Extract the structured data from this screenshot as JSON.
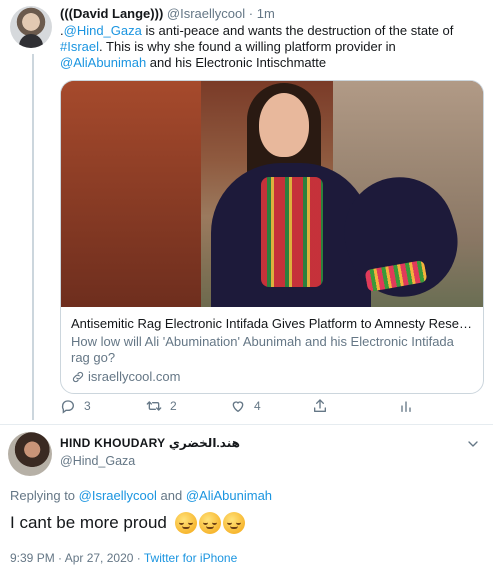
{
  "parent_tweet": {
    "display_name": "(((David Lange)))",
    "handle": "@Israellycool",
    "separator": "·",
    "time": "1m",
    "text_parts": [
      {
        "text": ".",
        "link": false
      },
      {
        "text": "@Hind_Gaza",
        "link": true
      },
      {
        "text": " is anti-peace and wants the destruction of the state of ",
        "link": false
      },
      {
        "text": "#Israel",
        "link": true
      },
      {
        "text": ". This is why she found a willing platform provider in ",
        "link": false
      },
      {
        "text": "@AliAbunimah",
        "link": true
      },
      {
        "text": " and his Electronic Intischmatte",
        "link": false
      }
    ],
    "card": {
      "title": "Antisemitic Rag Electronic Intifada Gives Platform to Amnesty Researche…",
      "description": "How low will Ali 'Abumination' Abunimah and his Electronic Intifada rag go?",
      "domain": "israellycool.com",
      "domain_icon": "link-icon"
    },
    "actions": {
      "reply_count": "3",
      "retweet_count": "2",
      "like_count": "4"
    }
  },
  "main_tweet": {
    "display_name": "HIND KHOUDARY هند.الخضري",
    "handle": "@Hind_Gaza",
    "replying_prefix": "Replying to",
    "replying_to": [
      "@Israellycool",
      "@AliAbunimah"
    ],
    "replying_joiner": "and",
    "text": "I cant be more proud",
    "emoji_count": 3,
    "emoji_name": "relieved-face-emoji",
    "timestamp": "9:39 PM · Apr 27, 2020",
    "source_separator": "·",
    "source": "Twitter for iPhone"
  },
  "colors": {
    "link": "#1b95e0",
    "muted": "#657786",
    "text": "#14171a",
    "border": "#ccd6dd"
  }
}
